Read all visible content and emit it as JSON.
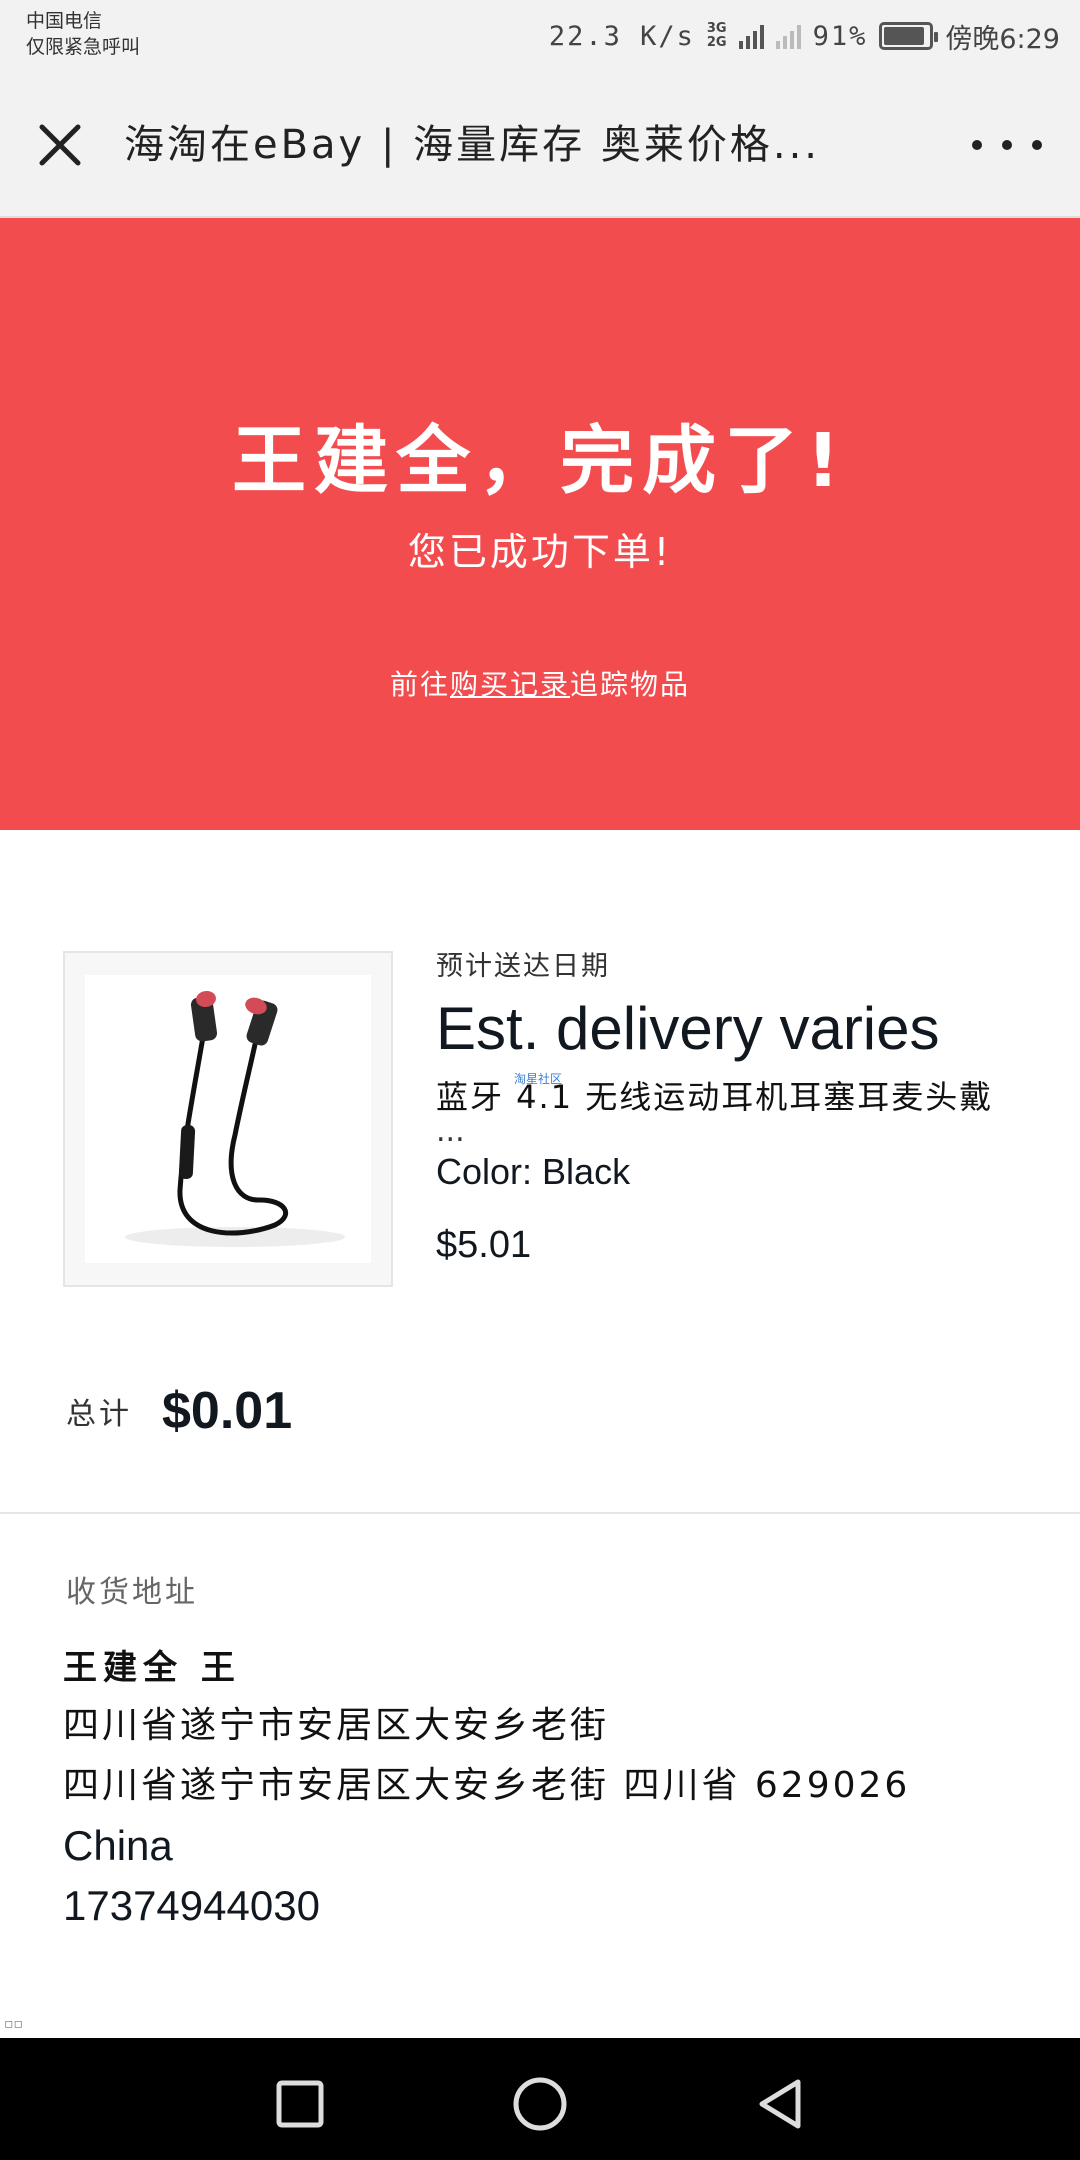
{
  "status_bar": {
    "carrier_line1": "中国电信",
    "carrier_line2": "仅限紧急呼叫",
    "net_speed": "22.3 K/s",
    "net_type_top": "3G",
    "net_type_bottom": "2G",
    "battery_percent": "91%",
    "battery_level": 0.91,
    "time": "傍晚6:29"
  },
  "title_bar": {
    "title": "海淘在eBay | 海量库存 奥莱价格..."
  },
  "hero": {
    "title": "王建全，完成了!",
    "subtitle": "您已成功下单!",
    "link_prefix": "前往",
    "link_text": "购买记录",
    "link_suffix": "追踪物品",
    "background": "#f24c4f"
  },
  "item": {
    "delivery_label": "预计送达日期",
    "delivery_value": "Est. delivery varies",
    "watermark": "淘星社区",
    "title": "蓝牙 4.1 无线运动耳机耳塞耳麦头戴",
    "ellipsis": "...",
    "color": "Color: Black",
    "price": "$5.01"
  },
  "total": {
    "label": "总计",
    "value": "$0.01"
  },
  "address": {
    "heading": "收货地址",
    "name": "王建全 王",
    "line1": "四川省遂宁市安居区大安乡老街",
    "line2": "四川省遂宁市安居区大安乡老街 四川省 629026",
    "country": "China",
    "phone": "17374944030"
  },
  "corner_mark": "▫▫"
}
